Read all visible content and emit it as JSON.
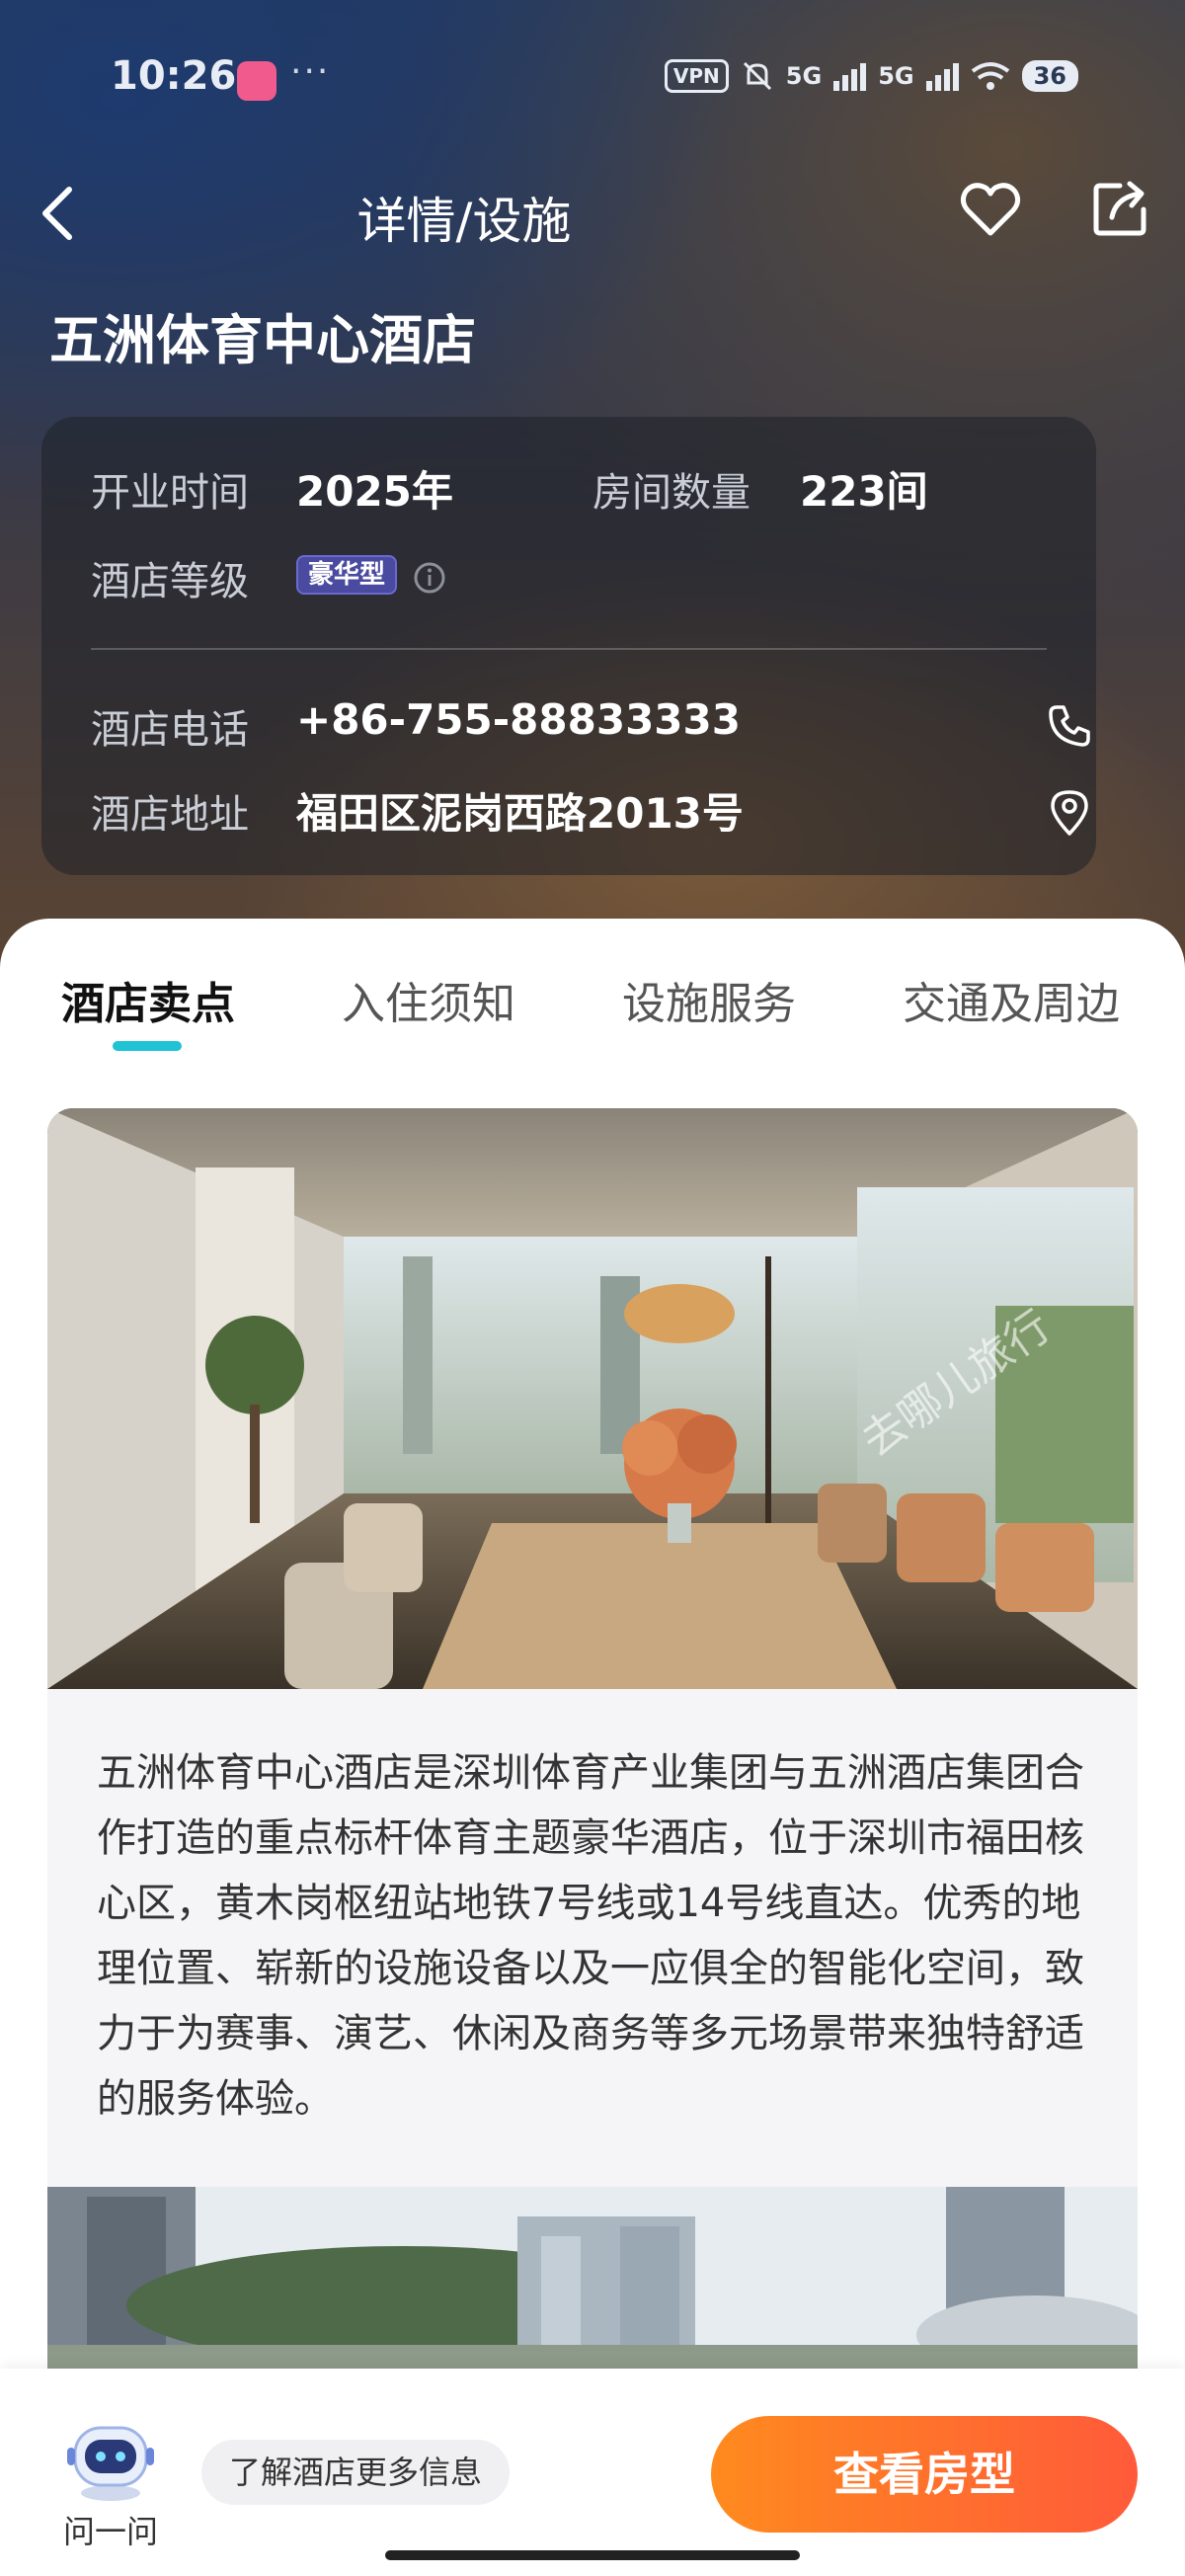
{
  "status_bar": {
    "time": "10:26",
    "dots": "···",
    "vpn": "VPN",
    "net1": "5G",
    "net2": "5G",
    "battery": "36"
  },
  "nav": {
    "title": "详情/设施"
  },
  "hotel": {
    "name": "五洲体育中心酒店",
    "open_label": "开业时间",
    "open_value": "2025年",
    "rooms_label": "房间数量",
    "rooms_value": "223间",
    "grade_label": "酒店等级",
    "grade_value": "豪华型",
    "phone_label": "酒店电话",
    "phone_value": "+86-755-88833333",
    "address_label": "酒店地址",
    "address_value": "福田区泥岗西路2013号"
  },
  "tabs": [
    {
      "label": "酒店卖点"
    },
    {
      "label": "入住须知"
    },
    {
      "label": "设施服务"
    },
    {
      "label": "交通及周边"
    }
  ],
  "content": {
    "description": "五洲体育中心酒店是深圳体育产业集团与五洲酒店集团合作打造的重点标杆体育主题豪华酒店，位于深圳市福田核心区，黄木岗枢纽站地铁7号线或14号线直达。优秀的地理位置、崭新的设施设备以及一应俱全的智能化空间，致力于为赛事、演艺、休闲及商务等多元场景带来独特舒适的服务体验。",
    "watermark": "去哪儿旅行"
  },
  "bottom": {
    "ask_label": "问一问",
    "more_info": "了解酒店更多信息",
    "cta": "查看房型"
  },
  "colors": {
    "accent_tab": "#1fc3d4",
    "cta_start": "#ff8a1e",
    "cta_end": "#ff5a3a",
    "badge": "#4a4aa0"
  }
}
